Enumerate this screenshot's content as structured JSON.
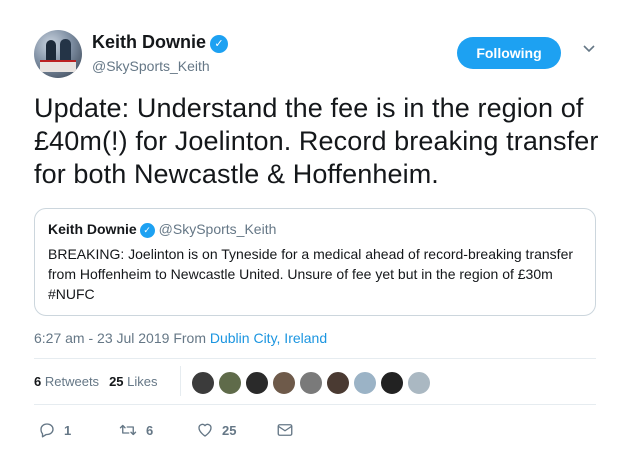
{
  "author": {
    "name": "Keith Downie",
    "handle": "@SkySports_Keith"
  },
  "follow_button": {
    "label": "Following"
  },
  "tweet": {
    "text": "Update: Understand the fee is in the region of £40m(!) for Joelinton. Record breaking transfer for both Newcastle & Hoffenheim."
  },
  "quoted_tweet": {
    "name": "Keith Downie",
    "handle": "@SkySports_Keith",
    "text": "BREAKING: Joelinton is on Tyneside for a medical ahead of record-breaking transfer from Hoffenheim to Newcastle United. Unsure of fee yet but in the region of £30m #NUFC"
  },
  "meta": {
    "time": "6:27 am - 23 Jul 2019",
    "from": "From",
    "location": "Dublin City, Ireland"
  },
  "stats": {
    "retweets_count": "6",
    "retweets_label": "Retweets",
    "likes_count": "25",
    "likes_label": "Likes"
  },
  "liker_avatars": [
    {
      "icon": "avatar-1",
      "color": "#3b3b3b"
    },
    {
      "icon": "avatar-2",
      "color": "#5f6b4a"
    },
    {
      "icon": "avatar-3",
      "color": "#2a2a2a"
    },
    {
      "icon": "avatar-4",
      "color": "#6e5a4a"
    },
    {
      "icon": "avatar-5",
      "color": "#7a7a7a"
    },
    {
      "icon": "avatar-6",
      "color": "#4a3a32"
    },
    {
      "icon": "avatar-7",
      "color": "#9bb3c6"
    },
    {
      "icon": "avatar-8",
      "color": "#222222"
    },
    {
      "icon": "avatar-9-default",
      "color": "#aab8c2"
    }
  ],
  "actions": {
    "reply_count": "1",
    "retweet_count": "6",
    "like_count": "25"
  },
  "colors": {
    "accent": "#1da1f2",
    "link": "#1b95e0",
    "secondary_text": "#657786",
    "border": "#ccd6dd"
  }
}
